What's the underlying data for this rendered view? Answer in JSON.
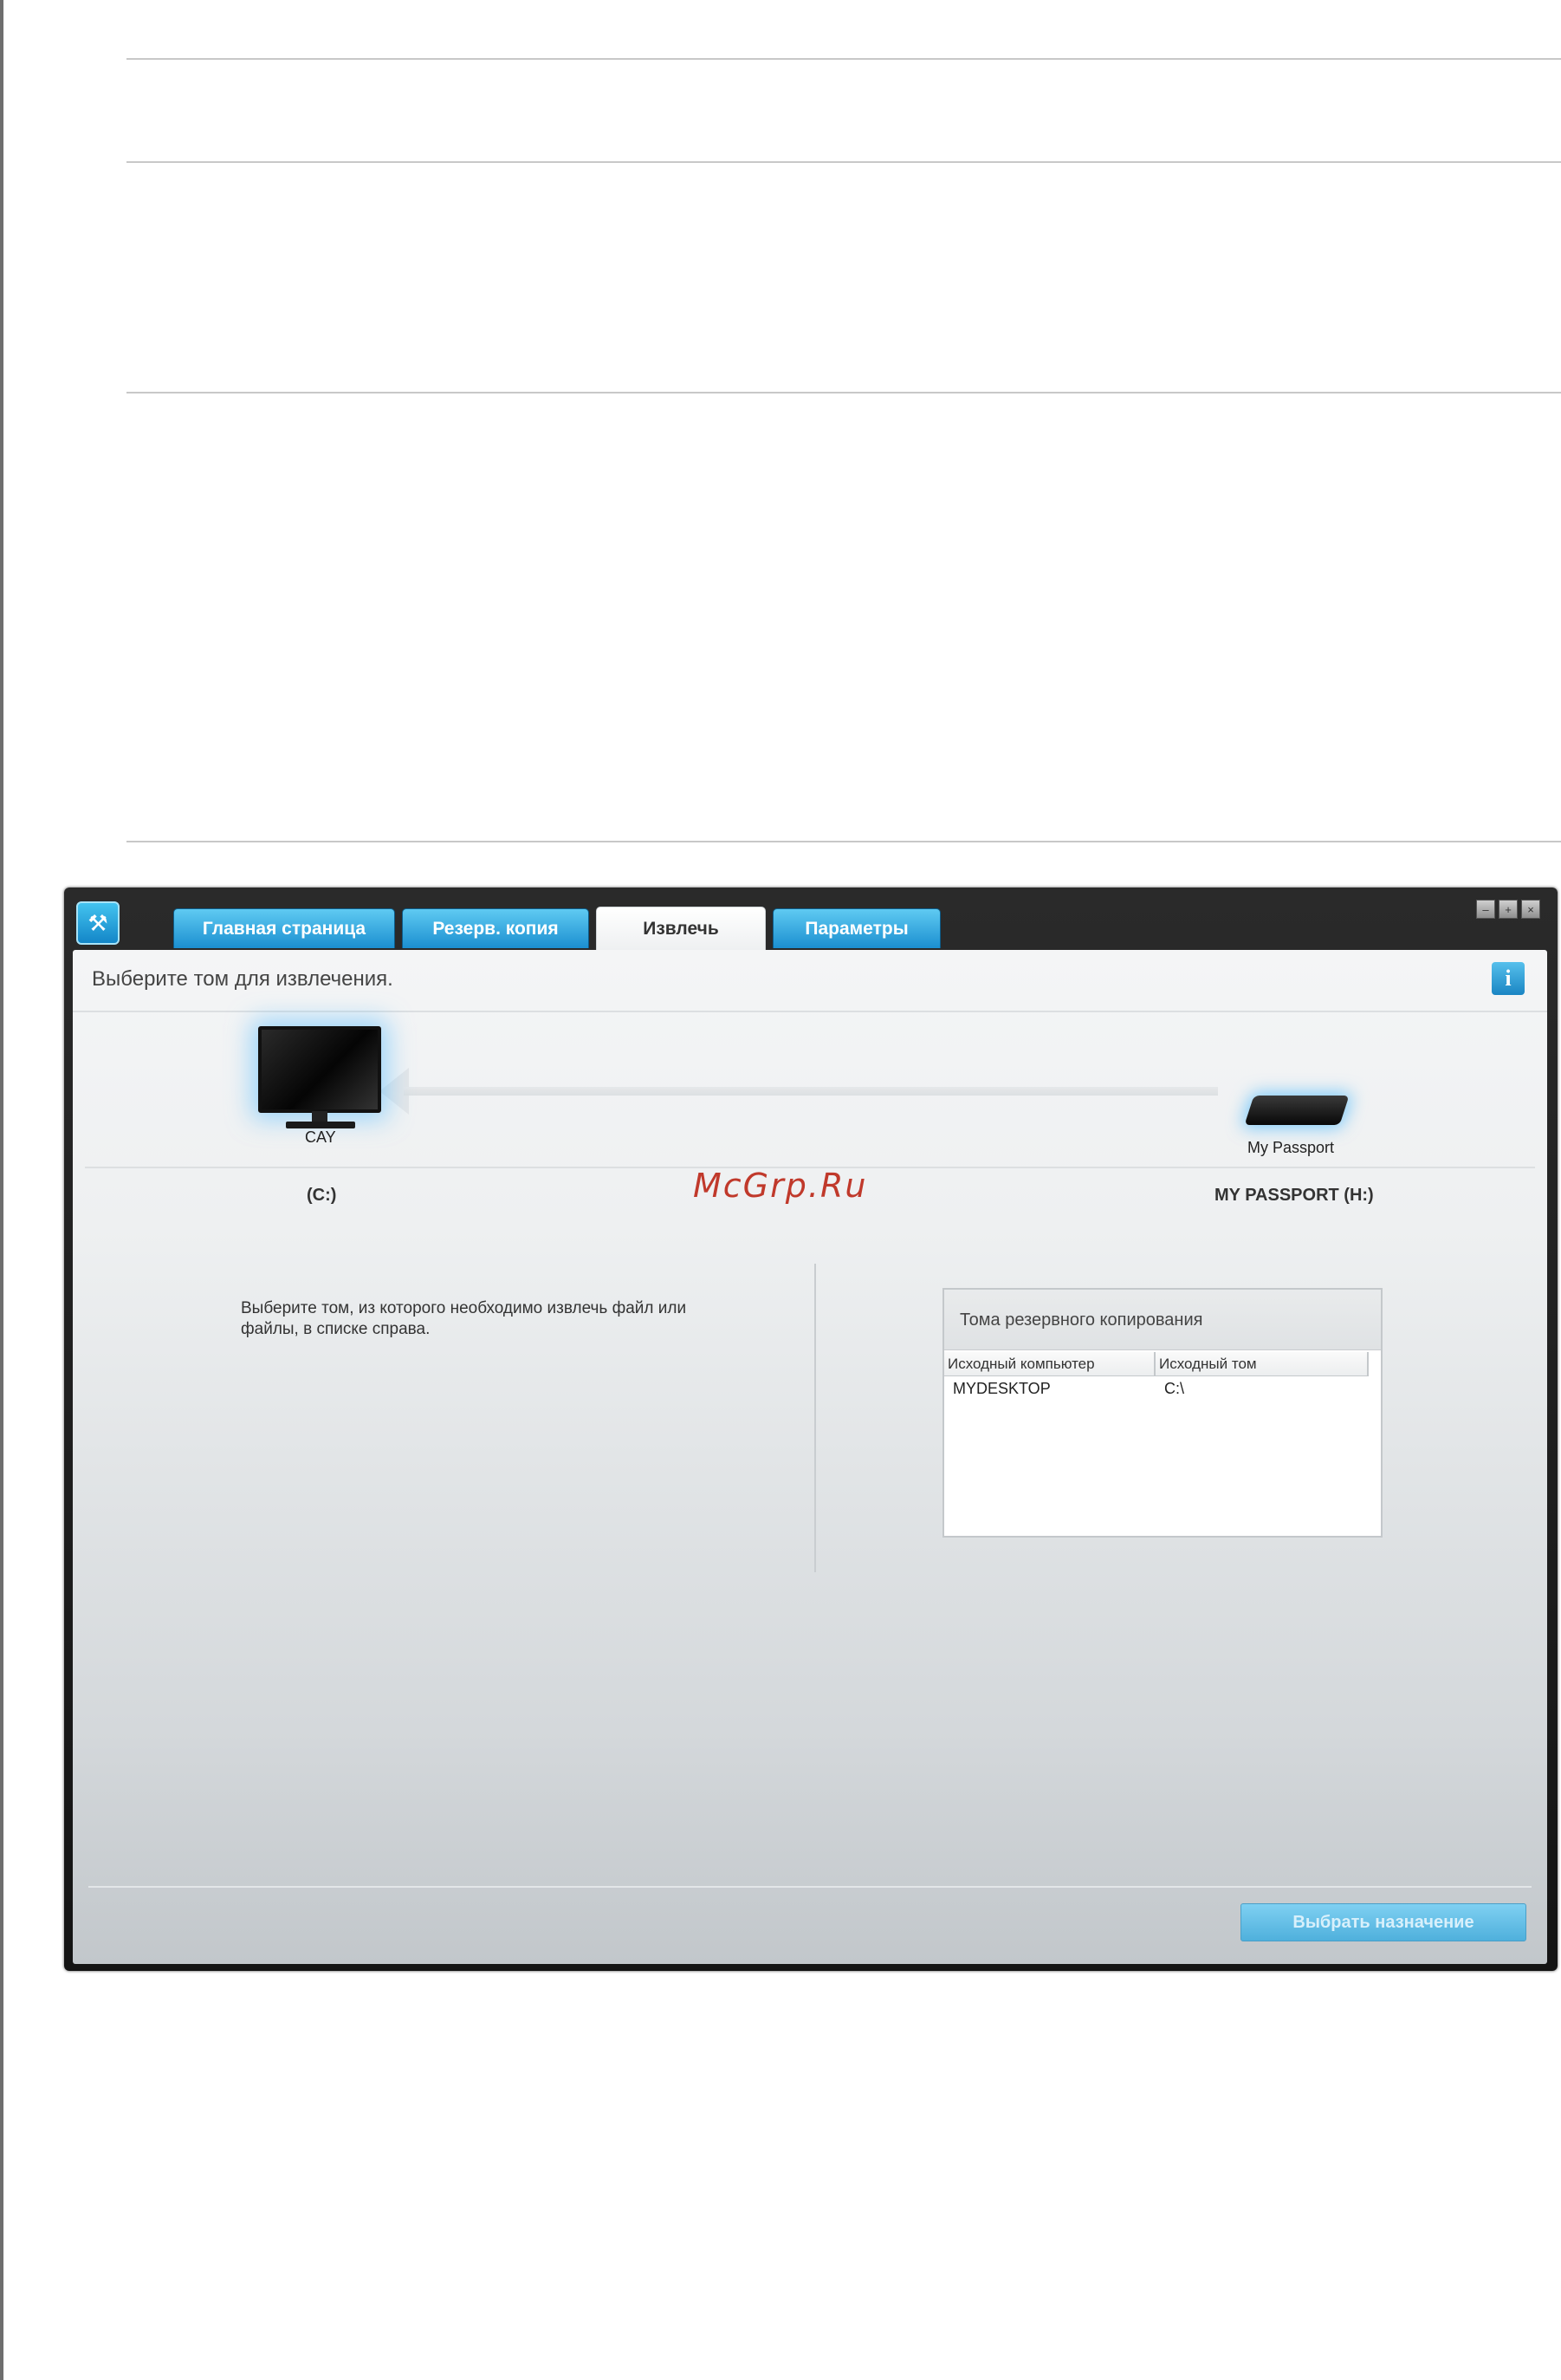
{
  "app": {
    "tabs": [
      {
        "label": "Главная страница"
      },
      {
        "label": "Резерв. копия"
      },
      {
        "label": "Извлечь"
      },
      {
        "label": "Параметры"
      }
    ],
    "active_tab": "Извлечь"
  },
  "header": {
    "instruction": "Выберите том для извлечения.",
    "info_label": "i"
  },
  "devices": {
    "computer_label": "CAY",
    "drive_label": "My Passport",
    "source_volume": "(C:)",
    "destination_volume": "MY PASSPORT (H:)"
  },
  "watermark": "McGrp.Ru",
  "left_panel": {
    "instruction": "Выберите том, из которого необходимо извлечь файл или файлы, в списке справа."
  },
  "backup_volumes": {
    "title": "Тома резервного копирования",
    "columns": [
      "Исходный компьютер",
      "Исходный том"
    ],
    "rows": [
      {
        "computer": "MYDESKTOP",
        "volume": "C:\\"
      }
    ]
  },
  "footer": {
    "choose_destination_label": "Выбрать назначение"
  }
}
